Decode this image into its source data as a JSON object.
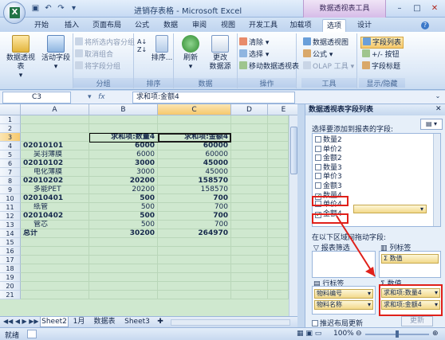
{
  "window": {
    "title": "进销存表格 - Microsoft Excel",
    "context_tool": "数据透视表工具"
  },
  "tabs": [
    "开始",
    "插入",
    "页面布局",
    "公式",
    "数据",
    "审阅",
    "视图",
    "开发工具",
    "加载项",
    "选项",
    "设计"
  ],
  "ribbon": {
    "groups": {
      "pivot": {
        "label": "",
        "btn1": "数据透视表",
        "btn2": "活动字段"
      },
      "group": {
        "label": "分组",
        "items": [
          "将所选内容分组",
          "取消组合",
          "将字段分组"
        ]
      },
      "sort": {
        "label": "排序",
        "btn": "排序..."
      },
      "data": {
        "label": "数据",
        "btn1": "刷新",
        "btn2a": "更改",
        "btn2b": "数据源"
      },
      "actions": {
        "label": "操作",
        "items": [
          "清除",
          "选择",
          "移动数据透视表"
        ]
      },
      "tools": {
        "label": "工具",
        "items": [
          "数据透视图",
          "公式",
          "OLAP 工具"
        ]
      },
      "show": {
        "label": "显示/隐藏",
        "items": [
          "字段列表",
          "+/- 按钮",
          "字段标题"
        ]
      }
    }
  },
  "formula_bar": {
    "name_box": "C3",
    "formula": "求和项:金额4"
  },
  "sheet": {
    "columns": [
      "A",
      "B",
      "C",
      "D",
      "E"
    ],
    "rows": [
      {
        "n": "1",
        "a": "",
        "b": "",
        "c": ""
      },
      {
        "n": "2",
        "a": "",
        "b": "",
        "c": ""
      },
      {
        "n": "3",
        "a": "",
        "b": "求和项:数量4",
        "c": "求和项:金额4"
      },
      {
        "n": "4",
        "a": "02010101",
        "b": "6000",
        "c": "60000"
      },
      {
        "n": "5",
        "a": "吴羽薄膜",
        "b": "6000",
        "c": "60000"
      },
      {
        "n": "6",
        "a": "02010102",
        "b": "3000",
        "c": "45000"
      },
      {
        "n": "7",
        "a": "电化薄膜",
        "b": "3000",
        "c": "45000"
      },
      {
        "n": "8",
        "a": "02010202",
        "b": "20200",
        "c": "158570"
      },
      {
        "n": "9",
        "a": "多能PET",
        "b": "20200",
        "c": "158570"
      },
      {
        "n": "10",
        "a": "02010401",
        "b": "500",
        "c": "700"
      },
      {
        "n": "11",
        "a": "纸管",
        "b": "500",
        "c": "700"
      },
      {
        "n": "12",
        "a": "02010402",
        "b": "500",
        "c": "700"
      },
      {
        "n": "13",
        "a": "管芯",
        "b": "500",
        "c": "700"
      },
      {
        "n": "14",
        "a": "总计",
        "b": "30200",
        "c": "264970"
      },
      {
        "n": "15",
        "a": "",
        "b": "",
        "c": ""
      },
      {
        "n": "16",
        "a": "",
        "b": "",
        "c": ""
      },
      {
        "n": "17",
        "a": "",
        "b": "",
        "c": ""
      },
      {
        "n": "18",
        "a": "",
        "b": "",
        "c": ""
      },
      {
        "n": "19",
        "a": "",
        "b": "",
        "c": ""
      },
      {
        "n": "20",
        "a": "",
        "b": "",
        "c": ""
      },
      {
        "n": "21",
        "a": "",
        "b": "",
        "c": ""
      }
    ],
    "sheet_tabs": [
      "Sheet2",
      "1月",
      "数据表",
      "Sheet3"
    ]
  },
  "pivot_panel": {
    "title": "数据透视表字段列表",
    "choose_label": "选择要添加到报表的字段:",
    "fields": [
      {
        "name": "数量2",
        "checked": false
      },
      {
        "name": "单价2",
        "checked": false
      },
      {
        "name": "金额2",
        "checked": false
      },
      {
        "name": "数量3",
        "checked": false
      },
      {
        "name": "单价3",
        "checked": false
      },
      {
        "name": "金额3",
        "checked": false
      },
      {
        "name": "数量4",
        "checked": true
      },
      {
        "name": "单价4",
        "checked": false
      },
      {
        "name": "金额4",
        "checked": true
      }
    ],
    "drag_label": "在以下区域间拖动字段:",
    "report_filter": "报表筛选",
    "col_label": "列标签",
    "col_chip": "Σ 数值",
    "row_label": "行标签",
    "values_label": "数值",
    "row_chips": [
      "物料编号",
      "物料名称"
    ],
    "value_chips": [
      "求和项:数量4",
      "求和项:金额4"
    ],
    "defer_label": "推迟布局更新",
    "update_btn": "更新"
  },
  "status": {
    "left": "就绪",
    "zoom": "100%"
  }
}
